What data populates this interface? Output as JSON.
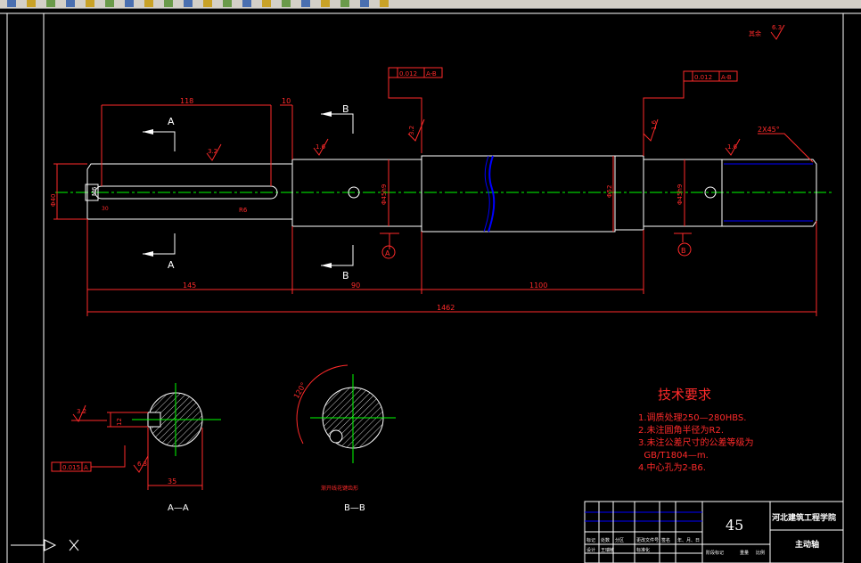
{
  "toolbar": {
    "icons": [
      "new-icon",
      "open-icon",
      "save-icon",
      "print-icon",
      "preview-icon",
      "cut-icon",
      "copy-icon",
      "paste-icon",
      "undo-icon",
      "redo-icon",
      "pan-icon",
      "zoom-realtime-icon",
      "zoom-window-icon",
      "zoom-previous-icon",
      "properties-icon",
      "design-center-icon",
      "tool-palettes-icon",
      "calculator-icon",
      "layer-icon",
      "color-icon"
    ]
  },
  "drawing": {
    "roughness_label": "其余",
    "roughness_corner": "6.3",
    "gtol_left": {
      "tol": "0.012",
      "datum": "A-B"
    },
    "gtol_right": {
      "tol": "0.012",
      "datum": "A-B"
    },
    "chamfer": "2X45°",
    "dims": {
      "d118": "118",
      "d10": "10",
      "d145": "145",
      "d90": "90",
      "d1100": "1100",
      "d1462": "1462",
      "dia_left": "Φ40",
      "dia_45a": "Φ45h9",
      "dia_45b": "Φ45h9",
      "dia_52": "Φ52",
      "m6": "M6",
      "d30": "30",
      "r6": "R6",
      "d35": "35"
    },
    "rough": {
      "r32a": "3.2",
      "r16a": "1.6",
      "r32b": "3.2",
      "r16b": "1.6",
      "r16c": "1.6",
      "r32c": "3.2",
      "r63": "6.3"
    },
    "sections": {
      "a_top": "A",
      "a_bottom": "A",
      "b_top": "B",
      "b_bottom": "B",
      "circle_a": "A",
      "circle_b": "B",
      "label_aa": "A—A",
      "label_bb": "B—B",
      "spline_note": "渐开线花键齿形",
      "angle": "120°",
      "key_width": "12",
      "sec_tol": "0.015",
      "sec_datum": "A"
    },
    "tech": {
      "title": "技术要求",
      "items": [
        "1.调质处理250—280HBS.",
        "2.未注圆角半径为R2.",
        "3.未注公差尺寸的公差等级为",
        "  GB/T1804—m.",
        "4.中心孔为2-B6."
      ]
    },
    "title_block": {
      "material": "45",
      "school": "河北建筑工程学院",
      "part_name": "主动轴",
      "row_labels": [
        "标记",
        "处数",
        "分区",
        "更改文件号",
        "签名",
        "年、月、日"
      ],
      "row2": [
        "设计",
        "王瑞敏",
        "标准化"
      ],
      "bottom": [
        "阶段标记",
        "重量",
        "比例"
      ]
    }
  }
}
